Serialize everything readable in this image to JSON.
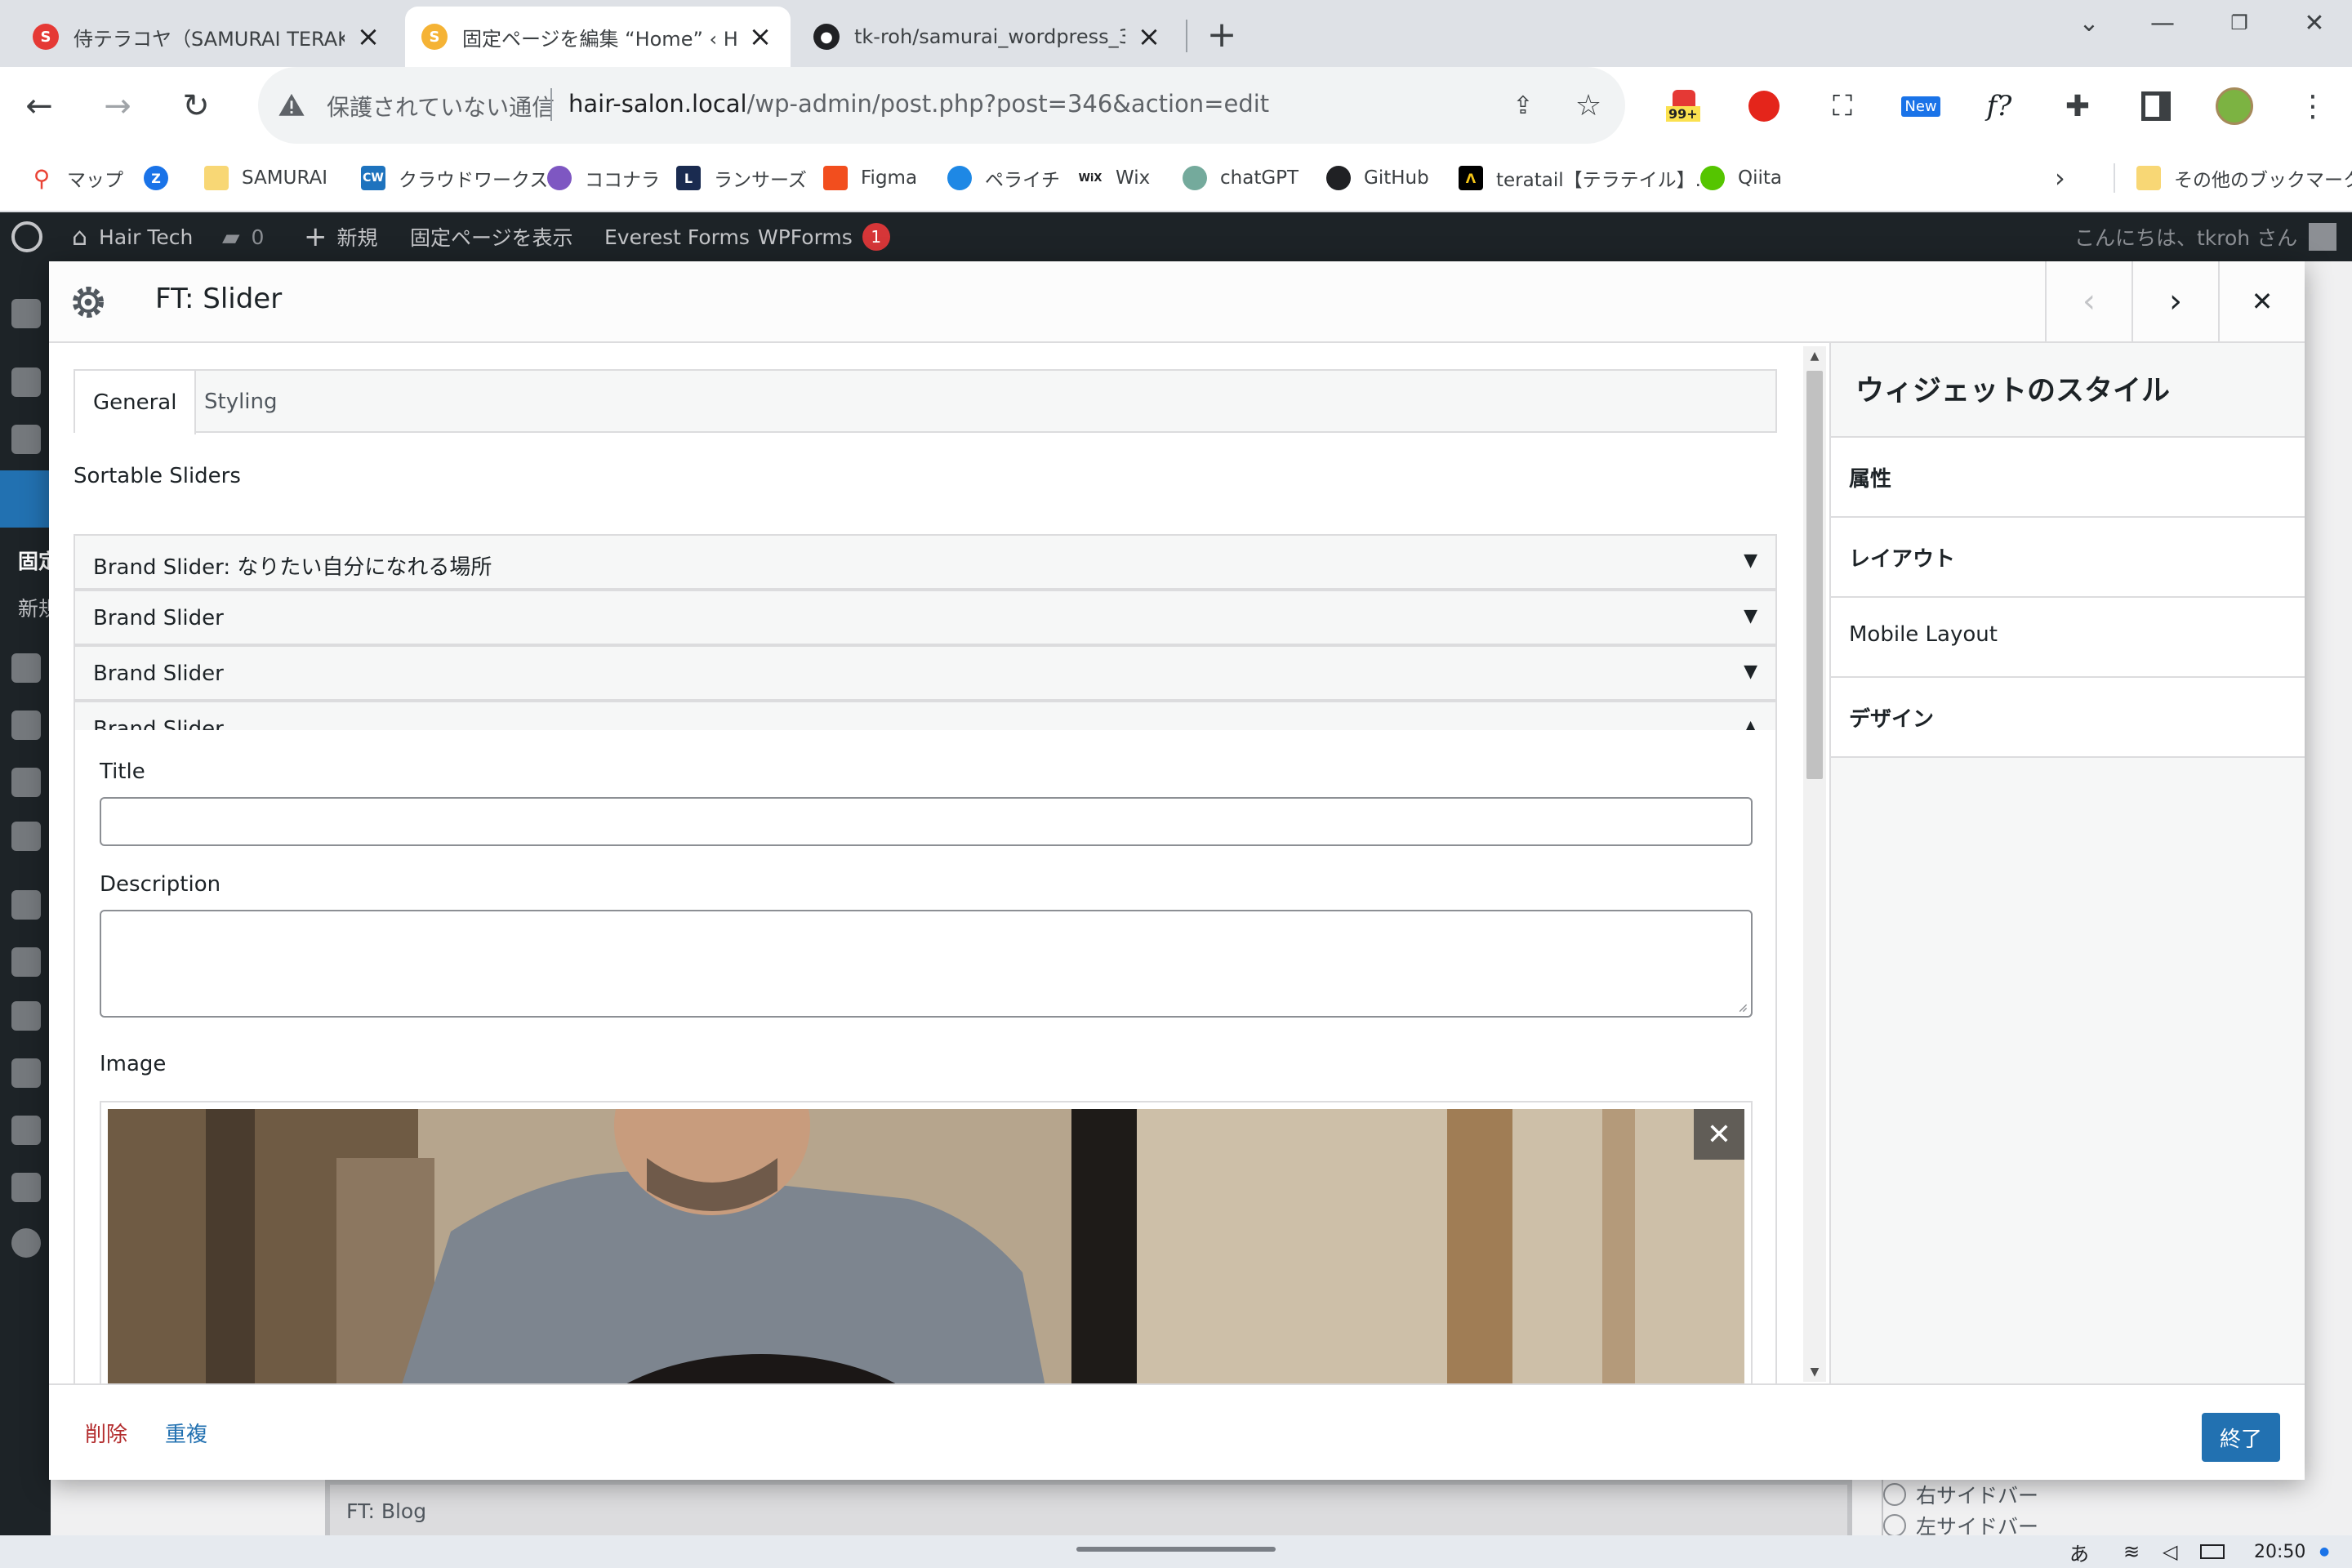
{
  "browser": {
    "tabs": [
      {
        "title": "侍テラコヤ（SAMURAI TERAKOYA）",
        "favicon": "samurai-icon",
        "active": false
      },
      {
        "title": "固定ページを編集 “Home” ‹ Hair Tech",
        "favicon": "samurai-s-icon",
        "active": true
      },
      {
        "title": "tk-roh/samurai_wordpress_3",
        "favicon": "github-icon",
        "active": false
      }
    ],
    "omnibox": {
      "security_text": "保護されていない通信",
      "url_host": "hair-salon.local",
      "url_path": "/wp-admin/post.php?post=346&action=edit"
    },
    "extension_badges": {
      "badge_count": "99+",
      "badge_new": "New",
      "fx_label": "f?"
    },
    "bookmarks": [
      {
        "label": "マップ",
        "icon": "maps-pin-icon"
      },
      {
        "label": "",
        "icon": "z-logo-icon"
      },
      {
        "label": "SAMURAI",
        "icon": "folder-icon"
      },
      {
        "label": "クラウドワークス",
        "icon": "crowdworks-icon"
      },
      {
        "label": "ココナラ",
        "icon": "coconala-icon"
      },
      {
        "label": "ランサーズ",
        "icon": "lancers-icon"
      },
      {
        "label": "Figma",
        "icon": "figma-icon"
      },
      {
        "label": "ペライチ",
        "icon": "peraichi-icon"
      },
      {
        "label": "Wix",
        "icon": "wix-icon"
      },
      {
        "label": "chatGPT",
        "icon": "openai-icon"
      },
      {
        "label": "GitHub",
        "icon": "github-icon"
      },
      {
        "label": "teratail【テラテイル】...",
        "icon": "teratail-icon"
      },
      {
        "label": "Qiita",
        "icon": "qiita-icon"
      }
    ],
    "bookmarks_other": "その他のブックマーク"
  },
  "adminbar": {
    "site_name": "Hair Tech",
    "comments_count": "0",
    "new_label": "新規",
    "view_page": "固定ページを表示",
    "everest_forms": "Everest Forms",
    "wpforms": "WPForms",
    "wpforms_count": "1",
    "greeting": "こんにちは、tkroh さん"
  },
  "behind": {
    "sidebar_fragment_1": "固定",
    "sidebar_fragment_2": "新規",
    "bottom_widget": "FT: Blog",
    "radio_1": "右サイドバー",
    "radio_2": "左サイドバー"
  },
  "modal": {
    "title": "FT: Slider",
    "tabs": [
      "General",
      "Styling"
    ],
    "sortable_label": "Sortable Sliders",
    "sliders": [
      {
        "label": "Brand Slider: なりたい自分になれる場所",
        "expanded": false
      },
      {
        "label": "Brand Slider",
        "expanded": false
      },
      {
        "label": "Brand Slider",
        "expanded": false
      },
      {
        "label": "Brand Slider",
        "expanded": true
      }
    ],
    "fields": {
      "title_label": "Title",
      "title_value": "",
      "description_label": "Description",
      "description_value": "",
      "image_label": "Image"
    },
    "style_panel": {
      "title": "ウィジェットのスタイル",
      "rows": [
        "属性",
        "レイアウト",
        "Mobile Layout",
        "デザイン"
      ]
    },
    "footer": {
      "delete": "削除",
      "duplicate": "重複",
      "done": "終了"
    }
  },
  "taskbar": {
    "ime": "あ",
    "time": "20:50"
  },
  "colors": {
    "wp_dark": "#1d2327",
    "wp_blue": "#2271b1",
    "delete_red": "#b32d2e",
    "link_blue": "#2271b1"
  }
}
